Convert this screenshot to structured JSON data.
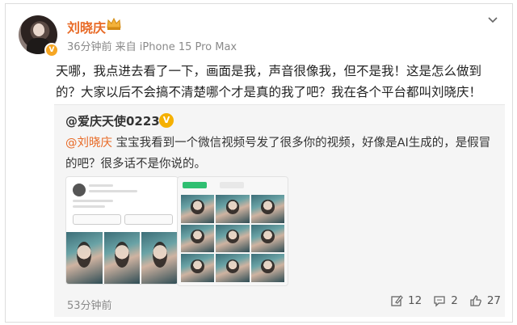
{
  "post": {
    "username": "刘晓庆",
    "meta": "36分钟前 来自 iPhone 15 Pro Max",
    "text": "天哪，我点进去看了一下，画面是我，声音很像我，但不是我！这是怎么做到的？大家以后不会搞不清楚哪个才是真的我了吧？我在各个平台都叫刘晓庆！",
    "verified_badge": "V"
  },
  "repost": {
    "username": "@爱庆天使0223",
    "mention": "@刘晓庆",
    "text": " 宝宝我看到一个微信视频号发了很多你的视频，好像是AI生成的，是假冒的吧？很多话不是你说的。"
  },
  "footer": {
    "time": "53分钟前",
    "reposts": "12",
    "comments": "2",
    "likes": "27"
  },
  "icons": {
    "more": "chevron-down-icon",
    "repost": "share-edit-icon",
    "comment": "comment-icon",
    "like": "thumbs-up-icon"
  },
  "colors": {
    "username": "#e86a26",
    "mention": "#e86a26",
    "repost_bg": "#f5f5f5",
    "meta": "#8a8a8a"
  }
}
